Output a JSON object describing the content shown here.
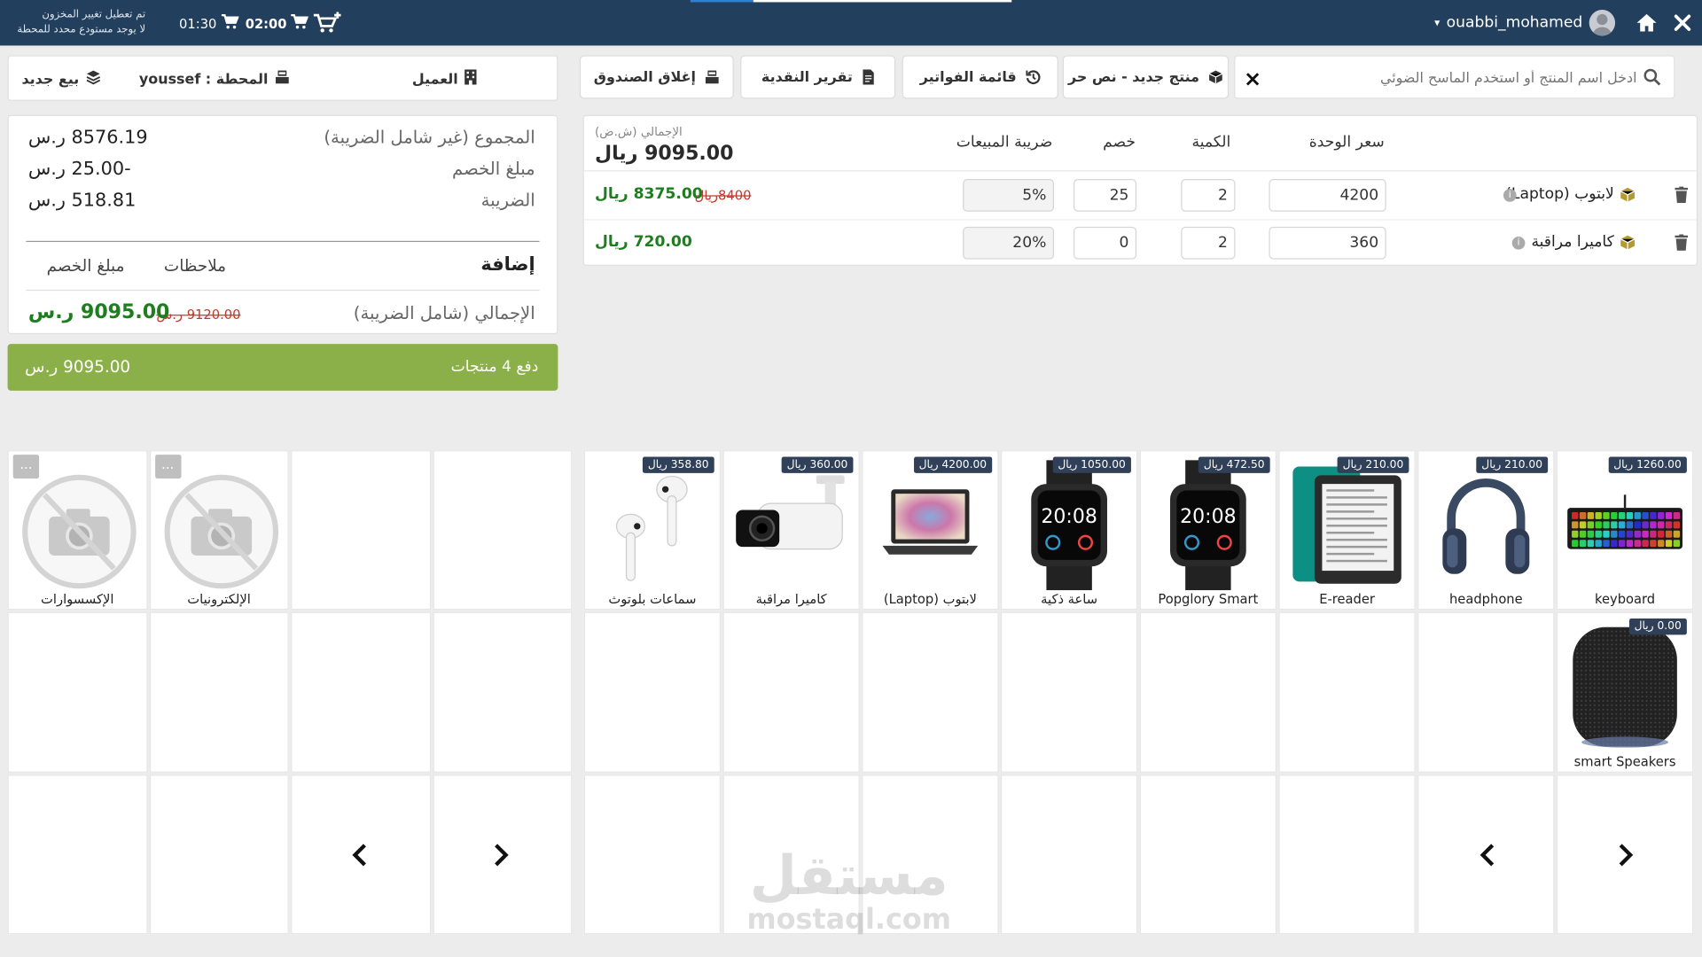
{
  "header": {
    "user_name": "ouabbi_mohamed",
    "timer1": "02:00",
    "timer2": "01:30",
    "notice_line1": "تم تعطيل تغيير المخزون",
    "notice_line2": "لا يوجد مستودع محدد للمحطة"
  },
  "toolbar": {
    "search_placeholder": "ادخل اسم المنتج أو استخدم الماسح الضوئي",
    "new_product": "منتج جديد - نص حر",
    "invoices": "قائمة الفواتير",
    "cash_report": "تقرير النقدية",
    "close_register": "إغلاق الصندوق"
  },
  "session": {
    "customer": "العميل",
    "station": "المحطة : youssef",
    "new_sale": "بيع جديد"
  },
  "cart": {
    "headers": {
      "unit_price": "سعر الوحدة",
      "quantity": "الكمية",
      "discount": "خصم",
      "sales_tax": "ضريبة المبيعات",
      "total_label": "الإجمالي (ش.ض)",
      "total_value": "9095.00 ريال"
    },
    "rows": [
      {
        "name": "لابتوب (Laptop)",
        "unit_price": "4200",
        "quantity": "2",
        "discount": "25",
        "tax": "5%",
        "old_total": "8400ريال",
        "total": "8375.00 ريال"
      },
      {
        "name": "كاميرا مراقبة",
        "unit_price": "360",
        "quantity": "2",
        "discount": "0",
        "tax": "20%",
        "old_total": "",
        "total": "720.00 ريال"
      }
    ]
  },
  "summary": {
    "subtotal_label": "المجموع (غير شامل الضريبة)",
    "subtotal_value": "8576.19 ر.س",
    "discount_label": "مبلغ الخصم",
    "discount_value": "-25.00 ر.س",
    "tax_label": "الضريبة",
    "tax_value": "518.81 ر.س",
    "add_label": "إضافة",
    "notes_label": "ملاحظات",
    "discount_amount_label": "مبلغ الخصم",
    "grand_label": "الإجمالي (شامل الضريبة)",
    "grand_old": "9120.00 ر.س",
    "grand_value": "9095.00 ر.س"
  },
  "pay": {
    "label": "دفع 4 منتجات",
    "amount": "9095.00 ر.س"
  },
  "categories": [
    {
      "label": "الإلكترونيات",
      "more": "..."
    },
    {
      "label": "الإكسسوارات",
      "more": "..."
    }
  ],
  "products": [
    {
      "label": "keyboard",
      "price": "1260.00 ريال",
      "icon": "keyboard-image"
    },
    {
      "label": "headphone",
      "price": "210.00 ريال",
      "icon": "headphone-image"
    },
    {
      "label": "E-reader",
      "price": "210.00 ريال",
      "icon": "ereader-image"
    },
    {
      "label": "Popglory Smart",
      "price": "472.50 ريال",
      "icon": "smartwatch-image"
    },
    {
      "label": "ساعة ذكية",
      "price": "1050.00 ريال",
      "icon": "smartwatch-image"
    },
    {
      "label": "لابتوب (Laptop)",
      "price": "4200.00 ريال",
      "icon": "laptop-image"
    },
    {
      "label": "كاميرا مراقبة",
      "price": "360.00 ريال",
      "icon": "camera-image"
    },
    {
      "label": "سماعات بلوتوث",
      "price": "358.80 ريال",
      "icon": "earbuds-image"
    },
    {
      "label": "smart Speakers",
      "price": "0.00 ريال",
      "icon": "speaker-image"
    }
  ],
  "watermark": {
    "line1": "مستقل",
    "line2": "mostaql.com"
  },
  "colors": {
    "topbar": "#223f5d",
    "pay_button": "#8bb04a",
    "price_green": "#1e7d1e",
    "strike_red": "#c0392b"
  }
}
